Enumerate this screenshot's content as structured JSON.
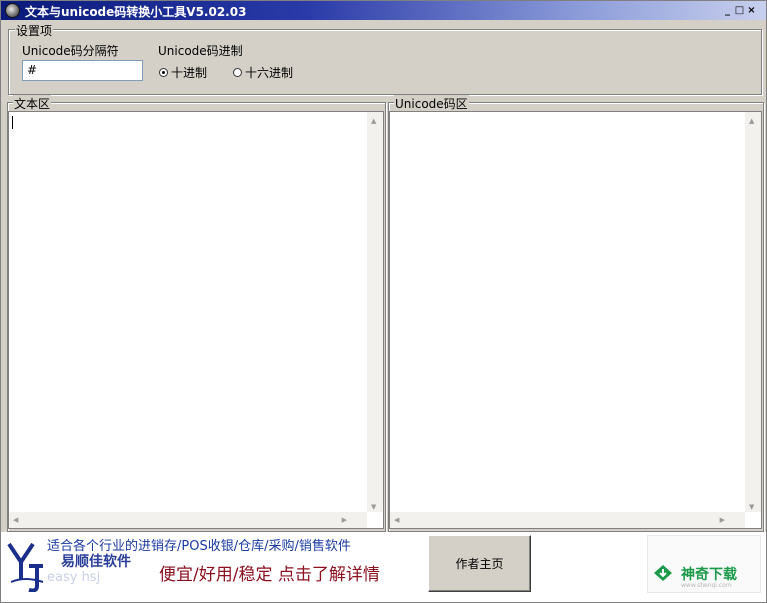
{
  "window": {
    "title": "文本与unicode码转换小工具V5.02.03",
    "min": "_",
    "max": "□",
    "close": "×"
  },
  "settings": {
    "group_label": "设置项",
    "separator_label": "Unicode码分隔符",
    "separator_value": "#",
    "base_label": "Unicode码进制",
    "radio_decimal": "十进制",
    "radio_hex": "十六进制"
  },
  "panels": {
    "text_label": "文本区",
    "text_value": "",
    "unicode_label": "Unicode码区",
    "unicode_value": ""
  },
  "banner": {
    "logo_letters": "Yj",
    "brand": "易顺佳软件",
    "brand_en": "easy hsj",
    "line1": "适合各个行业的进销存/POS收银/仓库/采购/销售软件",
    "line2": "便宜/好用/稳定 点击了解详情",
    "author_button": "作者主页",
    "watermark": "神奇下载",
    "watermark_url": "www.shenqi.com"
  }
}
